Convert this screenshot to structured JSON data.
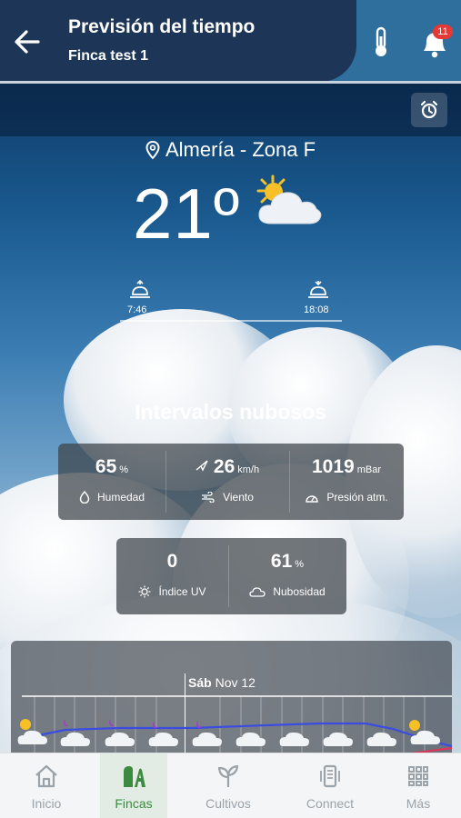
{
  "header": {
    "title": "Previsión del tiempo",
    "subtitle": "Finca test 1",
    "notifications_count": "11"
  },
  "weather": {
    "location": "Almería - Zona F",
    "temperature": "21º",
    "condition": "Intervalos nubosos",
    "sunrise": "7:46",
    "sunset": "18:08"
  },
  "metrics": {
    "humidity": {
      "value": "65",
      "unit": "%",
      "label": "Humedad"
    },
    "wind": {
      "value": "26",
      "unit": "km/h",
      "label": "Viento"
    },
    "pressure": {
      "value": "1019",
      "unit": "mBar",
      "label": "Presión atm."
    },
    "uv": {
      "value": "0",
      "label": "Índice UV"
    },
    "cloudiness": {
      "value": "61",
      "unit": "%",
      "label": "Nubosidad"
    }
  },
  "forecast": {
    "day_label": "Sáb",
    "date_label": "Nov 12"
  },
  "nav": {
    "items": [
      {
        "label": "Inicio",
        "icon": "home-icon"
      },
      {
        "label": "Fincas",
        "icon": "fincas-icon"
      },
      {
        "label": "Cultivos",
        "icon": "sprout-icon"
      },
      {
        "label": "Connect",
        "icon": "device-icon"
      },
      {
        "label": "Más",
        "icon": "grid-icon"
      }
    ],
    "active": "Fincas"
  },
  "colors": {
    "header_dark": "#1d3658",
    "header_light": "#2f6f9e",
    "badge": "#e53935",
    "nav_active": "#3a8a3f",
    "chart_line": "#3b4de0"
  }
}
